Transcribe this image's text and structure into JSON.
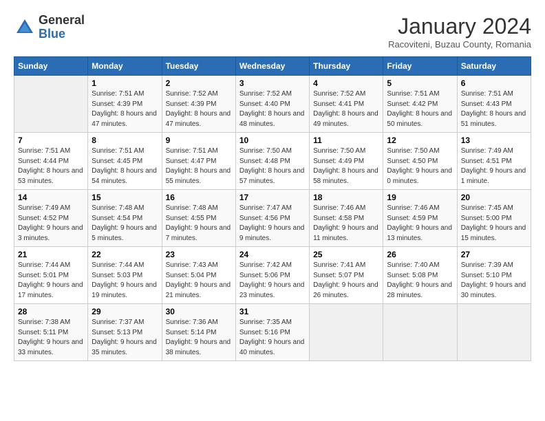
{
  "logo": {
    "general": "General",
    "blue": "Blue"
  },
  "title": "January 2024",
  "location": "Racoviteni, Buzau County, Romania",
  "days_of_week": [
    "Sunday",
    "Monday",
    "Tuesday",
    "Wednesday",
    "Thursday",
    "Friday",
    "Saturday"
  ],
  "weeks": [
    [
      {
        "num": "",
        "sunrise": "",
        "sunset": "",
        "daylight": ""
      },
      {
        "num": "1",
        "sunrise": "Sunrise: 7:51 AM",
        "sunset": "Sunset: 4:39 PM",
        "daylight": "Daylight: 8 hours and 47 minutes."
      },
      {
        "num": "2",
        "sunrise": "Sunrise: 7:52 AM",
        "sunset": "Sunset: 4:39 PM",
        "daylight": "Daylight: 8 hours and 47 minutes."
      },
      {
        "num": "3",
        "sunrise": "Sunrise: 7:52 AM",
        "sunset": "Sunset: 4:40 PM",
        "daylight": "Daylight: 8 hours and 48 minutes."
      },
      {
        "num": "4",
        "sunrise": "Sunrise: 7:52 AM",
        "sunset": "Sunset: 4:41 PM",
        "daylight": "Daylight: 8 hours and 49 minutes."
      },
      {
        "num": "5",
        "sunrise": "Sunrise: 7:51 AM",
        "sunset": "Sunset: 4:42 PM",
        "daylight": "Daylight: 8 hours and 50 minutes."
      },
      {
        "num": "6",
        "sunrise": "Sunrise: 7:51 AM",
        "sunset": "Sunset: 4:43 PM",
        "daylight": "Daylight: 8 hours and 51 minutes."
      }
    ],
    [
      {
        "num": "7",
        "sunrise": "Sunrise: 7:51 AM",
        "sunset": "Sunset: 4:44 PM",
        "daylight": "Daylight: 8 hours and 53 minutes."
      },
      {
        "num": "8",
        "sunrise": "Sunrise: 7:51 AM",
        "sunset": "Sunset: 4:45 PM",
        "daylight": "Daylight: 8 hours and 54 minutes."
      },
      {
        "num": "9",
        "sunrise": "Sunrise: 7:51 AM",
        "sunset": "Sunset: 4:47 PM",
        "daylight": "Daylight: 8 hours and 55 minutes."
      },
      {
        "num": "10",
        "sunrise": "Sunrise: 7:50 AM",
        "sunset": "Sunset: 4:48 PM",
        "daylight": "Daylight: 8 hours and 57 minutes."
      },
      {
        "num": "11",
        "sunrise": "Sunrise: 7:50 AM",
        "sunset": "Sunset: 4:49 PM",
        "daylight": "Daylight: 8 hours and 58 minutes."
      },
      {
        "num": "12",
        "sunrise": "Sunrise: 7:50 AM",
        "sunset": "Sunset: 4:50 PM",
        "daylight": "Daylight: 9 hours and 0 minutes."
      },
      {
        "num": "13",
        "sunrise": "Sunrise: 7:49 AM",
        "sunset": "Sunset: 4:51 PM",
        "daylight": "Daylight: 9 hours and 1 minute."
      }
    ],
    [
      {
        "num": "14",
        "sunrise": "Sunrise: 7:49 AM",
        "sunset": "Sunset: 4:52 PM",
        "daylight": "Daylight: 9 hours and 3 minutes."
      },
      {
        "num": "15",
        "sunrise": "Sunrise: 7:48 AM",
        "sunset": "Sunset: 4:54 PM",
        "daylight": "Daylight: 9 hours and 5 minutes."
      },
      {
        "num": "16",
        "sunrise": "Sunrise: 7:48 AM",
        "sunset": "Sunset: 4:55 PM",
        "daylight": "Daylight: 9 hours and 7 minutes."
      },
      {
        "num": "17",
        "sunrise": "Sunrise: 7:47 AM",
        "sunset": "Sunset: 4:56 PM",
        "daylight": "Daylight: 9 hours and 9 minutes."
      },
      {
        "num": "18",
        "sunrise": "Sunrise: 7:46 AM",
        "sunset": "Sunset: 4:58 PM",
        "daylight": "Daylight: 9 hours and 11 minutes."
      },
      {
        "num": "19",
        "sunrise": "Sunrise: 7:46 AM",
        "sunset": "Sunset: 4:59 PM",
        "daylight": "Daylight: 9 hours and 13 minutes."
      },
      {
        "num": "20",
        "sunrise": "Sunrise: 7:45 AM",
        "sunset": "Sunset: 5:00 PM",
        "daylight": "Daylight: 9 hours and 15 minutes."
      }
    ],
    [
      {
        "num": "21",
        "sunrise": "Sunrise: 7:44 AM",
        "sunset": "Sunset: 5:01 PM",
        "daylight": "Daylight: 9 hours and 17 minutes."
      },
      {
        "num": "22",
        "sunrise": "Sunrise: 7:44 AM",
        "sunset": "Sunset: 5:03 PM",
        "daylight": "Daylight: 9 hours and 19 minutes."
      },
      {
        "num": "23",
        "sunrise": "Sunrise: 7:43 AM",
        "sunset": "Sunset: 5:04 PM",
        "daylight": "Daylight: 9 hours and 21 minutes."
      },
      {
        "num": "24",
        "sunrise": "Sunrise: 7:42 AM",
        "sunset": "Sunset: 5:06 PM",
        "daylight": "Daylight: 9 hours and 23 minutes."
      },
      {
        "num": "25",
        "sunrise": "Sunrise: 7:41 AM",
        "sunset": "Sunset: 5:07 PM",
        "daylight": "Daylight: 9 hours and 26 minutes."
      },
      {
        "num": "26",
        "sunrise": "Sunrise: 7:40 AM",
        "sunset": "Sunset: 5:08 PM",
        "daylight": "Daylight: 9 hours and 28 minutes."
      },
      {
        "num": "27",
        "sunrise": "Sunrise: 7:39 AM",
        "sunset": "Sunset: 5:10 PM",
        "daylight": "Daylight: 9 hours and 30 minutes."
      }
    ],
    [
      {
        "num": "28",
        "sunrise": "Sunrise: 7:38 AM",
        "sunset": "Sunset: 5:11 PM",
        "daylight": "Daylight: 9 hours and 33 minutes."
      },
      {
        "num": "29",
        "sunrise": "Sunrise: 7:37 AM",
        "sunset": "Sunset: 5:13 PM",
        "daylight": "Daylight: 9 hours and 35 minutes."
      },
      {
        "num": "30",
        "sunrise": "Sunrise: 7:36 AM",
        "sunset": "Sunset: 5:14 PM",
        "daylight": "Daylight: 9 hours and 38 minutes."
      },
      {
        "num": "31",
        "sunrise": "Sunrise: 7:35 AM",
        "sunset": "Sunset: 5:16 PM",
        "daylight": "Daylight: 9 hours and 40 minutes."
      },
      {
        "num": "",
        "sunrise": "",
        "sunset": "",
        "daylight": ""
      },
      {
        "num": "",
        "sunrise": "",
        "sunset": "",
        "daylight": ""
      },
      {
        "num": "",
        "sunrise": "",
        "sunset": "",
        "daylight": ""
      }
    ]
  ]
}
